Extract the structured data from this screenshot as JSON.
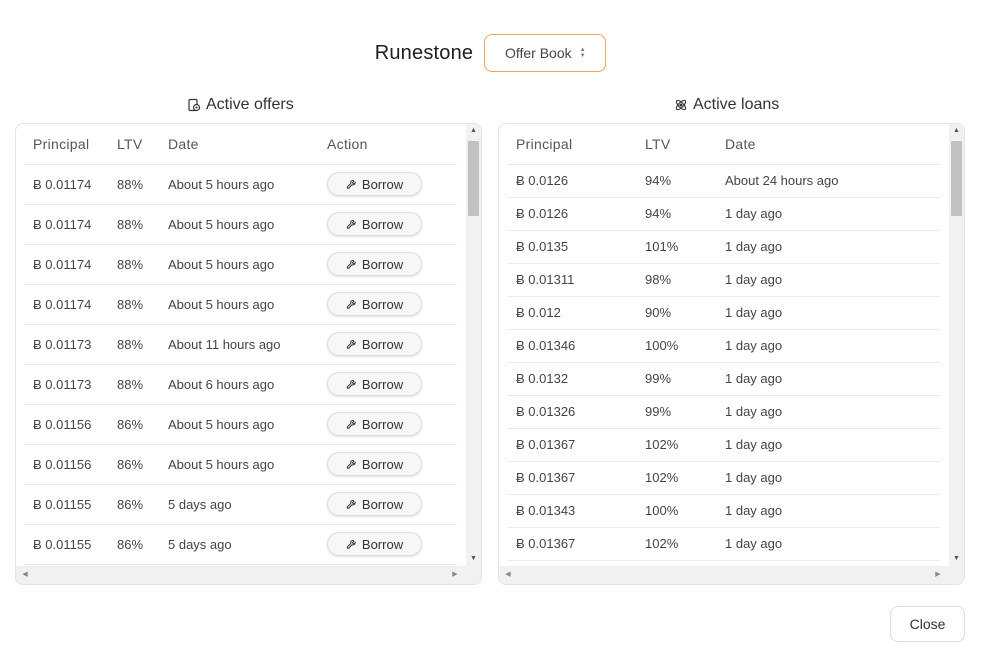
{
  "header": {
    "app_title": "Runestone",
    "view_select": "Offer Book"
  },
  "offers": {
    "title": "Active offers",
    "columns": [
      "Principal",
      "LTV",
      "Date",
      "Action"
    ],
    "rows": [
      {
        "principal": "Ƀ 0.01174",
        "ltv": "88%",
        "date": "About 5 hours ago",
        "action": "Borrow"
      },
      {
        "principal": "Ƀ 0.01174",
        "ltv": "88%",
        "date": "About 5 hours ago",
        "action": "Borrow"
      },
      {
        "principal": "Ƀ 0.01174",
        "ltv": "88%",
        "date": "About 5 hours ago",
        "action": "Borrow"
      },
      {
        "principal": "Ƀ 0.01174",
        "ltv": "88%",
        "date": "About 5 hours ago",
        "action": "Borrow"
      },
      {
        "principal": "Ƀ 0.01173",
        "ltv": "88%",
        "date": "About 11 hours ago",
        "action": "Borrow"
      },
      {
        "principal": "Ƀ 0.01173",
        "ltv": "88%",
        "date": "About 6 hours ago",
        "action": "Borrow"
      },
      {
        "principal": "Ƀ 0.01156",
        "ltv": "86%",
        "date": "About 5 hours ago",
        "action": "Borrow"
      },
      {
        "principal": "Ƀ 0.01156",
        "ltv": "86%",
        "date": "About 5 hours ago",
        "action": "Borrow"
      },
      {
        "principal": "Ƀ 0.01155",
        "ltv": "86%",
        "date": "5 days ago",
        "action": "Borrow"
      },
      {
        "principal": "Ƀ 0.01155",
        "ltv": "86%",
        "date": "5 days ago",
        "action": "Borrow"
      }
    ]
  },
  "loans": {
    "title": "Active loans",
    "columns": [
      "Principal",
      "LTV",
      "Date"
    ],
    "rows": [
      {
        "principal": "Ƀ 0.0126",
        "ltv": "94%",
        "date": "About 24 hours ago"
      },
      {
        "principal": "Ƀ 0.0126",
        "ltv": "94%",
        "date": "1 day ago"
      },
      {
        "principal": "Ƀ 0.0135",
        "ltv": "101%",
        "date": "1 day ago"
      },
      {
        "principal": "Ƀ 0.01311",
        "ltv": "98%",
        "date": "1 day ago"
      },
      {
        "principal": "Ƀ 0.012",
        "ltv": "90%",
        "date": "1 day ago"
      },
      {
        "principal": "Ƀ 0.01346",
        "ltv": "100%",
        "date": "1 day ago"
      },
      {
        "principal": "Ƀ 0.0132",
        "ltv": "99%",
        "date": "1 day ago"
      },
      {
        "principal": "Ƀ 0.01326",
        "ltv": "99%",
        "date": "1 day ago"
      },
      {
        "principal": "Ƀ 0.01367",
        "ltv": "102%",
        "date": "1 day ago"
      },
      {
        "principal": "Ƀ 0.01367",
        "ltv": "102%",
        "date": "1 day ago"
      },
      {
        "principal": "Ƀ 0.01343",
        "ltv": "100%",
        "date": "1 day ago"
      },
      {
        "principal": "Ƀ 0.01367",
        "ltv": "102%",
        "date": "1 day ago"
      }
    ]
  },
  "footer": {
    "close_label": "Close"
  },
  "colors": {
    "accent_border": "#f0a35a",
    "row_border": "#ececec",
    "scroll_thumb": "#c1c1c1"
  },
  "icons": {
    "offers_title_icon": "offer-icon",
    "loans_title_icon": "atom-icon",
    "borrow_icon": "wrench-icon",
    "select_icon": "chevron-updown-icon"
  }
}
